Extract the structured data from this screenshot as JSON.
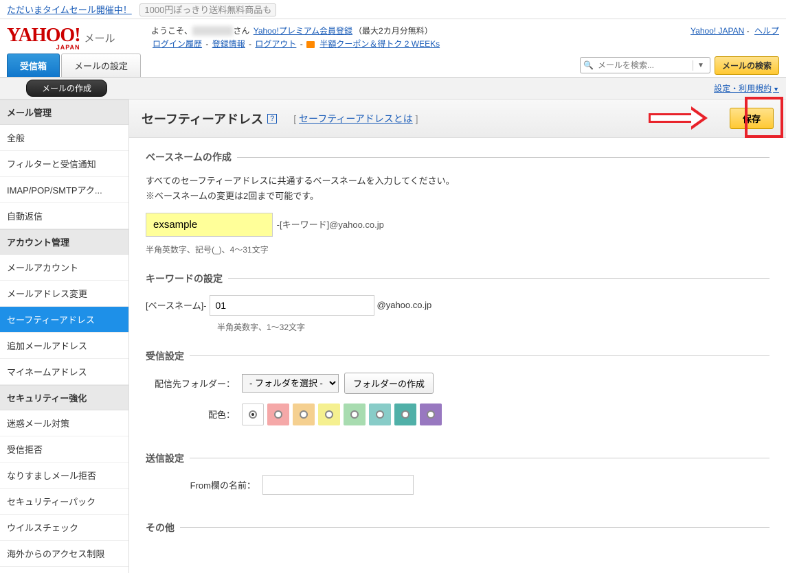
{
  "topBanner": {
    "sale": "ただいまタイムセール開催中！",
    "promo": "1000円ぽっきり送料無料商品も"
  },
  "logo": {
    "brand": "YAHOO!",
    "region": "JAPAN",
    "service": "メール"
  },
  "headerInfo": {
    "greeting": "ようこそ、",
    "userSuffix": "さん",
    "premiumLink": "Yahoo!プレミアム会員登録",
    "premiumNote": "（最大2カ月分無料）",
    "loginHistory": "ログイン履歴",
    "regInfo": "登録情報",
    "logout": "ログアウト",
    "coupon": "半額クーポン＆得トク 2 WEEKs"
  },
  "headerRight": {
    "japan": "Yahoo! JAPAN",
    "help": "ヘルプ"
  },
  "tabs": {
    "inbox": "受信箱",
    "settings": "メールの設定"
  },
  "search": {
    "placeholder": "メールを検索...",
    "button": "メールの検索"
  },
  "subbar": {
    "compose": "メールの作成",
    "settings": "設定・利用規約"
  },
  "sidebar": {
    "mailMgmt": {
      "header": "メール管理",
      "items": [
        "全般",
        "フィルターと受信通知",
        "IMAP/POP/SMTPアク...",
        "自動返信"
      ]
    },
    "acctMgmt": {
      "header": "アカウント管理",
      "items": [
        "メールアカウント",
        "メールアドレス変更",
        "セーフティーアドレス",
        "追加メールアドレス",
        "マイネームアドレス"
      ]
    },
    "security": {
      "header": "セキュリティー強化",
      "items": [
        "迷惑メール対策",
        "受信拒否",
        "なりすましメール拒否",
        "セキュリティーパック",
        "ウイルスチェック",
        "海外からのアクセス制限"
      ]
    }
  },
  "content": {
    "title": "セーフティーアドレス",
    "whatIsPrefix": "[ ",
    "whatIs": "セーフティーアドレスとは",
    "whatIsSuffix": " ]",
    "save": "保存"
  },
  "basename": {
    "legend": "ベースネームの作成",
    "desc1": "すべてのセーフティーアドレスに共通するベースネームを入力してください。",
    "desc2": "※ベースネームの変更は2回まで可能です。",
    "value": "exsample",
    "suffix": "-[キーワード]@yahoo.co.jp",
    "hint": "半角英数字、記号(_)、4～31文字"
  },
  "keyword": {
    "legend": "キーワードの設定",
    "prefix": "[ベースネーム]-",
    "value": "01",
    "suffix": "@yahoo.co.jp",
    "hint": "半角英数字、1～32文字"
  },
  "receive": {
    "legend": "受信設定",
    "folderLabel": "配信先フォルダー：",
    "folderSelect": "- フォルダを選択 -",
    "folderCreate": "フォルダーの作成",
    "colorLabel": "配色："
  },
  "send": {
    "legend": "送信設定",
    "fromLabel": "From欄の名前："
  },
  "other": {
    "legend": "その他"
  }
}
